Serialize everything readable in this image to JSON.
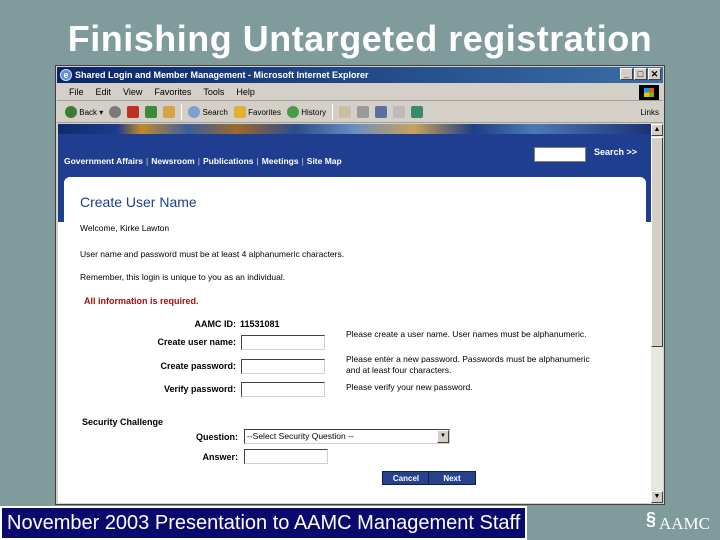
{
  "slide": {
    "title": "Finishing Untargeted registration",
    "footer": "November 2003 Presentation to AAMC Management Staff",
    "logo_text": "AAMC"
  },
  "window": {
    "title": "Shared Login and Member Management - Microsoft Internet Explorer",
    "controls": [
      "_",
      "□",
      "✕"
    ]
  },
  "menu": [
    "File",
    "Edit",
    "View",
    "Favorites",
    "Tools",
    "Help"
  ],
  "toolbar": {
    "back": "Back",
    "search": "Search",
    "favorites": "Favorites",
    "history": "History",
    "links": "Links"
  },
  "site": {
    "nav": [
      "Government Affairs",
      "Newsroom",
      "Publications",
      "Meetings",
      "Site Map"
    ],
    "search_label": "Search >>"
  },
  "form": {
    "heading": "Create User Name",
    "welcome": "Welcome, Kirke Lawton",
    "rule": "User name and password must be at least 4 alphanumeric characters.",
    "remember": "Remember, this login is unique to you as an individual.",
    "required": "All information is required.",
    "aamc_id_label": "AAMC ID:",
    "aamc_id_value": "11531081",
    "username_label": "Create user name:",
    "password_label": "Create password:",
    "verify_label": "Verify password:",
    "hint_username": "Please create a user name. User names must be alphanumeric.",
    "hint_password": "Please enter a new password. Passwords must be alphanumeric and at least four characters.",
    "hint_verify": "Please verify your new password.",
    "security_heading": "Security Challenge",
    "question_label": "Question:",
    "question_selected": "--Select Security Question --",
    "answer_label": "Answer:",
    "cancel": "Cancel",
    "next": "Next"
  },
  "colors": {
    "slide_bg": "#7f9b9b",
    "footer_bg": "#0a0a6e",
    "site_blue": "#1f3e8f",
    "required_red": "#a01010"
  }
}
